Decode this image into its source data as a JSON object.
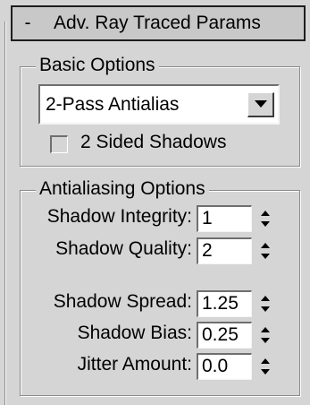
{
  "rollout": {
    "collapse_symbol": "-",
    "title": "Adv. Ray Traced Params"
  },
  "basic_options": {
    "title": "Basic Options",
    "mode_dropdown": {
      "value": "2-Pass Antialias",
      "arrow_icon": "dropdown-arrow-icon"
    },
    "two_sided_shadows": {
      "label": "2 Sided Shadows",
      "checked": false
    }
  },
  "antialiasing_options": {
    "title": "Antialiasing Options",
    "shadow_integrity": {
      "label": "Shadow Integrity:",
      "value": "1"
    },
    "shadow_quality": {
      "label": "Shadow Quality:",
      "value": "2"
    },
    "shadow_spread": {
      "label": "Shadow Spread:",
      "value": "1.25"
    },
    "shadow_bias": {
      "label": "Shadow Bias:",
      "value": "0.25"
    },
    "jitter_amount": {
      "label": "Jitter Amount:",
      "value": "0.0"
    }
  },
  "colors": {
    "panel_bg": "#d5d5d5",
    "header_border": "#1e1e1e",
    "field_bg": "#ffffff"
  }
}
